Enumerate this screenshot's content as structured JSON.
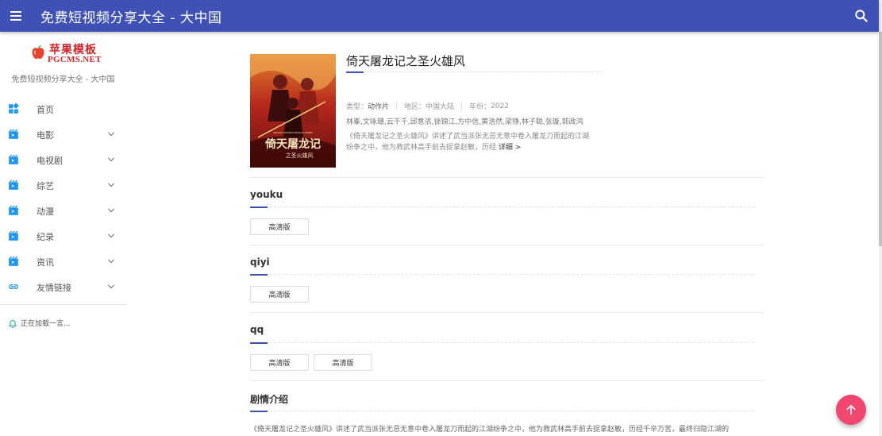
{
  "header": {
    "title": "免费短视频分享大全 - 大中国"
  },
  "sidebar": {
    "logo_text_cn": "苹果模板",
    "logo_text_en": "PGCMS.NET",
    "site_subtitle": "免费短视频分享大全 - 大中国",
    "items": [
      {
        "label": "首页",
        "icon": "dashboard-icon",
        "has_chevron": false
      },
      {
        "label": "电影",
        "icon": "movie-icon",
        "has_chevron": true
      },
      {
        "label": "电视剧",
        "icon": "movie-icon",
        "has_chevron": true
      },
      {
        "label": "综艺",
        "icon": "movie-icon",
        "has_chevron": true
      },
      {
        "label": "动漫",
        "icon": "movie-icon",
        "has_chevron": true
      },
      {
        "label": "纪录",
        "icon": "movie-icon",
        "has_chevron": true
      },
      {
        "label": "资讯",
        "icon": "movie-icon",
        "has_chevron": true
      },
      {
        "label": "友情链接",
        "icon": "link-icon",
        "has_chevron": true
      }
    ],
    "loading_text": "正在加载一言..."
  },
  "movie": {
    "title": "倚天屠龙记之圣火雄风",
    "type_label": "类型：",
    "type_value": "动作片",
    "region_label": "地区：",
    "region_value": "中国大陆",
    "year_label": "年份：",
    "year_value": "2022",
    "actors": "林峯,文咏珊,云千千,邱意浓,徐锦江,方中信,黄浩然,梁铮,林子聪,张璇,郭政鸿",
    "description_line1": "《倚天屠龙记之圣火雄风》讲述了武当派张无忌无意中卷入屠龙刀而起的江湖",
    "description_line2": "纷争之中，他为救武林高手前去捉拿赵敏，历经",
    "more_label": "详细 >",
    "poster_title_art": "倚天屠龙记",
    "poster_subtitle_art": "之圣火雄风",
    "poster_en_art": "HEAVEN SWORD DRAGON SABER"
  },
  "sources": [
    {
      "name": "youku",
      "episodes": [
        "高清版"
      ]
    },
    {
      "name": "qiyi",
      "episodes": [
        "高清版"
      ]
    },
    {
      "name": "qq",
      "episodes": [
        "高清版",
        "高清版"
      ]
    }
  ],
  "intro": {
    "heading": "剧情介绍",
    "text": "《倚天屠龙记之圣火雄风》讲述了武当派张无忌无意中卷入屠龙刀而起的江湖纷争之中，他为救武林高手前去捉拿赵敏，历经千辛万苦，最终归隐江湖的"
  },
  "colors": {
    "primary": "#3f51b5",
    "accent": "#ef476f",
    "icon": "#2196f3"
  }
}
